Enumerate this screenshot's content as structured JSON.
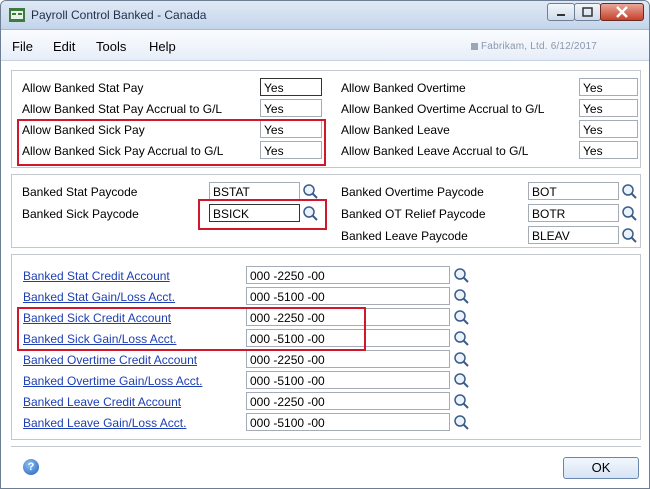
{
  "window": {
    "title": "Payroll Control Banked - Canada"
  },
  "menu": {
    "items": [
      "File",
      "Edit",
      "Tools",
      "Help"
    ]
  },
  "company": "Fabrikam, Ltd. 6/12/2017",
  "options_left": [
    {
      "label": "Allow Banked Stat Pay",
      "value": "Yes"
    },
    {
      "label": "Allow Banked Stat Pay Accrual to G/L",
      "value": "Yes"
    },
    {
      "label": "Allow Banked Sick Pay",
      "value": "Yes"
    },
    {
      "label": "Allow Banked Sick Pay Accrual to G/L",
      "value": "Yes"
    }
  ],
  "options_right": [
    {
      "label": "Allow Banked Overtime",
      "value": "Yes"
    },
    {
      "label": "Allow Banked Overtime Accrual to G/L",
      "value": "Yes"
    },
    {
      "label": "Allow Banked Leave",
      "value": "Yes"
    },
    {
      "label": "Allow Banked Leave Accrual to G/L",
      "value": "Yes"
    }
  ],
  "paycodes_left": [
    {
      "label": "Banked Stat Paycode",
      "value": "BSTAT"
    },
    {
      "label": "Banked Sick Paycode",
      "value": "BSICK"
    }
  ],
  "paycodes_right": [
    {
      "label": "Banked Overtime Paycode",
      "value": "BOT"
    },
    {
      "label": "Banked OT Relief Paycode",
      "value": "BOTR"
    },
    {
      "label": "Banked Leave Paycode",
      "value": "BLEAV"
    }
  ],
  "accounts": [
    {
      "label": "Banked Stat Credit Account",
      "value": "000 -2250 -00"
    },
    {
      "label": "Banked Stat Gain/Loss Acct.",
      "value": "000 -5100 -00"
    },
    {
      "label": "Banked Sick Credit Account",
      "value": "000 -2250 -00"
    },
    {
      "label": "Banked Sick Gain/Loss Acct.",
      "value": "000 -5100 -00"
    },
    {
      "label": "Banked Overtime Credit Account",
      "value": "000 -2250 -00"
    },
    {
      "label": "Banked Overtime Gain/Loss Acct.",
      "value": "000 -5100 -00"
    },
    {
      "label": "Banked Leave Credit Account",
      "value": "000 -2250 -00"
    },
    {
      "label": "Banked Leave Gain/Loss Acct.",
      "value": "000 -5100 -00"
    }
  ],
  "footer": {
    "ok_label": "OK"
  },
  "colors": {
    "highlight": "#d0172c",
    "link": "#1d3fb3"
  }
}
